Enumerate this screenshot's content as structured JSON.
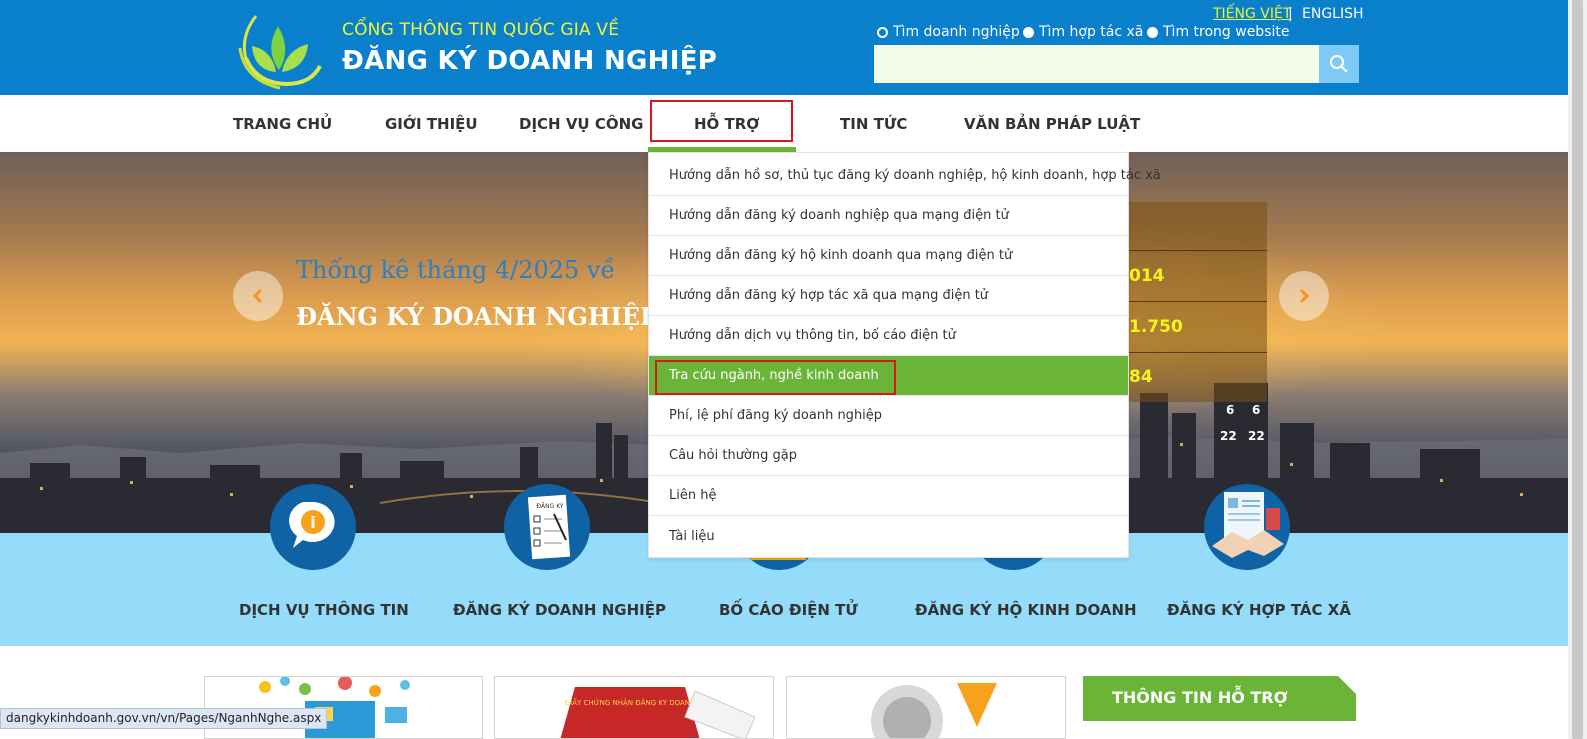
{
  "header": {
    "site_subtitle": "CỔNG THÔNG TIN QUỐC GIA VỀ",
    "site_title": "ĐĂNG KÝ DOANH NGHIỆP",
    "lang_vi": "TIẾNG VIỆT",
    "lang_sep": "|",
    "lang_en": "ENGLISH",
    "search_options": [
      "Tìm doanh nghiệp",
      "Tìm hợp tác xã",
      "Tìm trong website"
    ],
    "search_selected": "Tìm doanh nghiệp",
    "search_value": ""
  },
  "nav": {
    "items": [
      "TRANG CHỦ",
      "GIỚI THIỆU",
      "DỊCH VỤ CÔNG",
      "HỖ TRỢ",
      "TIN TỨC",
      "VĂN BẢN PHÁP LUẬT"
    ],
    "active": "HỖ TRỢ"
  },
  "dropdown": {
    "items": [
      "Hướng dẫn hồ sơ, thủ tục đăng ký doanh nghiệp, hộ kinh doanh, hợp tác xã",
      "Hướng dẫn đăng ký doanh nghiệp qua mạng điện tử",
      "Hướng dẫn đăng ký hộ kinh doanh qua mạng điện tử",
      "Hướng dẫn đăng ký hợp tác xã qua mạng điện tử",
      "Hướng dẫn dịch vụ thông tin, bố cáo điện tử",
      "Tra cứu ngành, nghề kinh doanh",
      "Phí, lệ phí đăng ký doanh nghiệp",
      "Câu hỏi thường gặp",
      "Liên hệ",
      "Tài liệu"
    ],
    "active": "Tra cứu ngành, nghề kinh doanh"
  },
  "banner": {
    "title_line1": "Thống kê tháng 4/2025 về",
    "title_line2": "ĐĂNG KÝ DOANH NGHIỆP",
    "stat_values": [
      "014",
      "1.750",
      "84"
    ],
    "tower_numbers": [
      "6",
      "6",
      "22",
      "22"
    ]
  },
  "services": {
    "labels": [
      "DỊCH VỤ THÔNG TIN",
      "ĐĂNG KÝ DOANH NGHIỆP",
      "BỐ CÁO ĐIỆN TỬ",
      "ĐĂNG KÝ HỘ KINH DOANH",
      "ĐĂNG KÝ HỢP TÁC XÃ"
    ],
    "doc_icon_text": "ĐĂNG KÝ",
    "info_icon_text": "i"
  },
  "bottom": {
    "support_title": "THÔNG TIN HỖ TRỢ",
    "card2_text": "GIẤY CHỨNG NHẬN ĐĂNG KÝ DOANH"
  },
  "statusbar": {
    "url": "dangkykinhdoanh.gov.vn/vn/Pages/NganhNghe.aspx"
  },
  "colors": {
    "header_blue": "#0a7fcc",
    "accent_green": "#6ab538",
    "highlight_red": "#d9161c",
    "service_strip": "#95dbfa",
    "subtitle_yellow": "#f1f53a"
  }
}
